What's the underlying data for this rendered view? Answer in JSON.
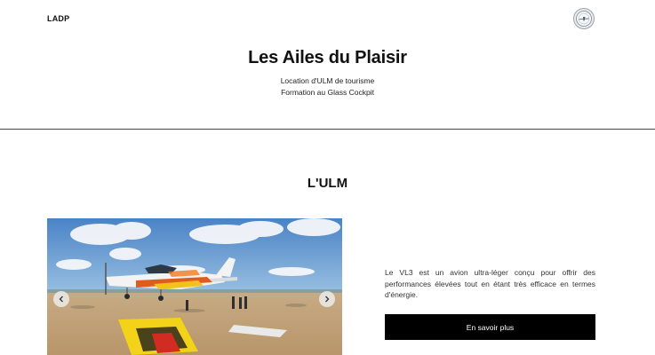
{
  "header": {
    "brand": "LADP",
    "logo_icon": "club-badge-icon"
  },
  "hero": {
    "title": "Les Ailes du Plaisir",
    "subtitle_line1": "Location d'ULM de tourisme",
    "subtitle_line2": "Formation au Glass Cockpit"
  },
  "section": {
    "title": "L'ULM",
    "description": "Le VL3 est un avion ultra-léger conçu pour offrir des performances élevées tout en étant très efficace en termes d'énergie.",
    "cta_label": "En savoir plus"
  },
  "carousel": {
    "prev_icon": "chevron-left-icon",
    "next_icon": "chevron-right-icon",
    "image_subject": "ultralight-aircraft-photo"
  },
  "colors": {
    "text": "#111111",
    "button_bg": "#000000",
    "button_text": "#ffffff",
    "divider": "#444444"
  }
}
